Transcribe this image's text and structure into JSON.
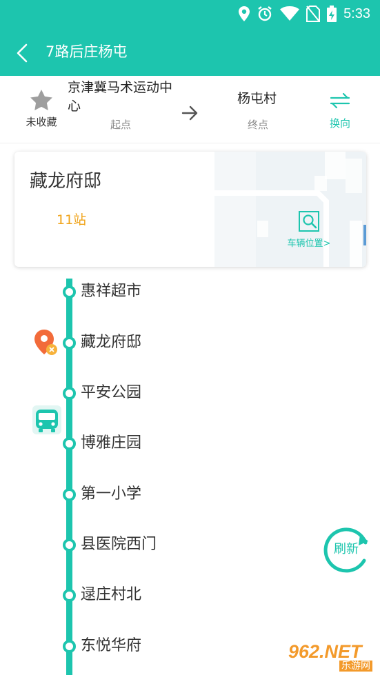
{
  "status_bar": {
    "time": "5:33",
    "icons": [
      "location-icon",
      "alarm-icon",
      "wifi-icon",
      "no-sim-icon",
      "battery-charging-icon"
    ]
  },
  "app_bar": {
    "title": "7路后庄杨屯"
  },
  "route": {
    "favorite_label": "未收藏",
    "origin_name": "京津冀马术运动中心",
    "origin_label": "起点",
    "destination_name": "杨屯村",
    "destination_label": "终点",
    "swap_label": "换向"
  },
  "current": {
    "station": "藏龙府邸",
    "stops": "11站",
    "vehicle_position_label": "车辆位置>"
  },
  "stops": [
    {
      "name": "惠祥超市"
    },
    {
      "name": "藏龙府邸"
    },
    {
      "name": "平安公园"
    },
    {
      "name": "博雅庄园"
    },
    {
      "name": "第一小学"
    },
    {
      "name": "县医院西门"
    },
    {
      "name": "逯庄村北"
    },
    {
      "name": "东悦华府"
    }
  ],
  "refresh_label": "刷新",
  "watermark": {
    "brand": "962.NET",
    "tagline": "乐游网"
  },
  "colors": {
    "primary": "#1dc5ae",
    "accent_orange": "#f0a41b",
    "location_marker": "#f26b3a",
    "text": "#333333",
    "muted": "#888888"
  }
}
